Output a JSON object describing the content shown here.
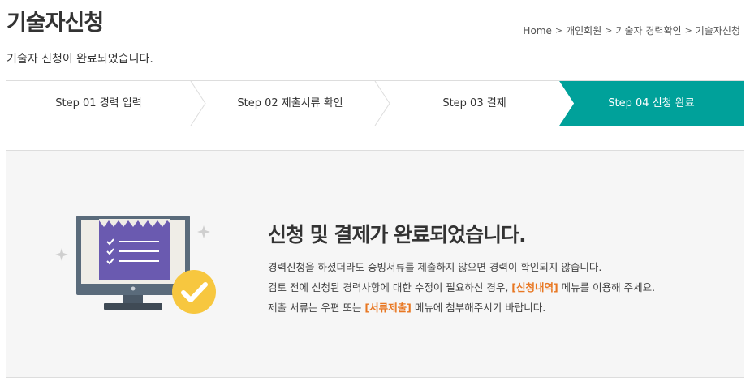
{
  "header": {
    "title": "기술자신청",
    "subtitle": "기술자 신청이 완료되었습니다."
  },
  "breadcrumb": [
    "Home",
    "개인회원",
    "기술자 경력확인",
    "기술자신청"
  ],
  "steps": [
    {
      "label": "Step 01 경력 입력",
      "active": false
    },
    {
      "label": "Step 02 제출서류 확인",
      "active": false
    },
    {
      "label": "Step 03 결제",
      "active": false
    },
    {
      "label": "Step 04 신청 완료",
      "active": true
    }
  ],
  "colors": {
    "active_step": "#00a19a",
    "highlight": "#e87722",
    "panel_bg": "#f6f6f6"
  },
  "complete": {
    "title": "신청 및 결제가 완료되었습니다.",
    "line1": "경력신청을 하셨더라도 증빙서류를 제출하지 않으면 경력이 확인되지 않습니다.",
    "line2_pre": "검토 전에 신청된 경력사항에 대한 수정이 필요하신 경우, ",
    "line2_link": "[신청내역]",
    "line2_post": " 메뉴를 이용해 주세요.",
    "line3_pre": "제출 서류는 우편 또는 ",
    "line3_link": "[서류제출]",
    "line3_post": " 메뉴에 첨부해주시기 바랍니다."
  },
  "icons": {
    "illustration": "monitor-document-check-icon",
    "breadcrumb_separator": "chevron-right-icon"
  }
}
